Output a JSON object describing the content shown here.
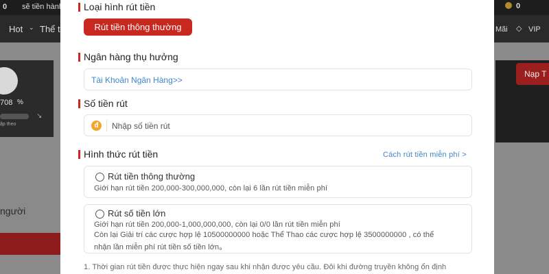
{
  "background": {
    "topbar_text": "sẽ tiền hành t",
    "coin_count": "0",
    "nav_hot": "Hot",
    "nav_the": "Thể t",
    "nav_mai": "Mãi",
    "nav_vip": "VIP",
    "stat_value": "708",
    "stat_small": "ập theo",
    "side_text": "người",
    "nap_button": "Nạp T"
  },
  "modal": {
    "withdraw_type": {
      "title": "Loại hình rút tiền",
      "button_label": "Rút tiền thông thường"
    },
    "beneficiary": {
      "title": "Ngân hàng thụ hưởng",
      "bank_link": "Tài Khoản Ngân Hàng>>"
    },
    "amount": {
      "title": "Số tiền rút",
      "currency_icon": "đ",
      "placeholder": "Nhập số tiền rút"
    },
    "method": {
      "title": "Hình thức rút tiền",
      "free_link": "Cách rút tiền miễn phí >",
      "options": [
        {
          "label": "Rút tiền thông thường",
          "lines": [
            "Giới hạn rút tiền 200,000-300,000,000, còn lại 6 lần rút tiền miễn phí"
          ]
        },
        {
          "label": "Rút số tiền lớn",
          "lines": [
            "Giới hạn rút tiền 200,000-1,000,000,000, còn lại 0/0 lần rút tiền miễn phí",
            "Còn lại Giải trí các cược hợp lệ 10500000000 hoặc Thể Thao các cược hợp lệ 3500000000 , có thể",
            "nhận lần miễn phí rút tiền số tiền lớn。"
          ]
        }
      ]
    },
    "note": "1. Thời gian rút tiền được thực hiện ngay sau khi nhận được yêu cầu. Đôi khi đường truyền không ổn định"
  }
}
